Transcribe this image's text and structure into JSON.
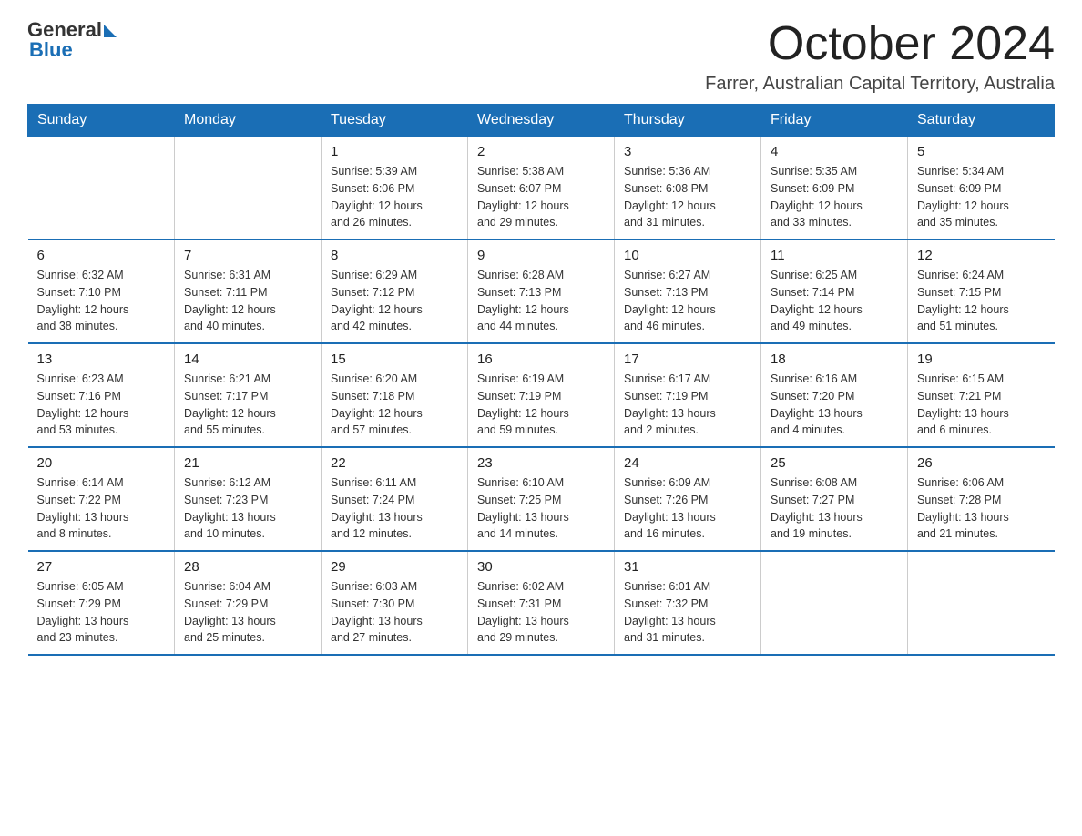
{
  "header": {
    "logo_general": "General",
    "logo_blue": "Blue",
    "title": "October 2024",
    "subtitle": "Farrer, Australian Capital Territory, Australia"
  },
  "calendar": {
    "days_of_week": [
      "Sunday",
      "Monday",
      "Tuesday",
      "Wednesday",
      "Thursday",
      "Friday",
      "Saturday"
    ],
    "weeks": [
      [
        {
          "day": "",
          "info": ""
        },
        {
          "day": "",
          "info": ""
        },
        {
          "day": "1",
          "info": "Sunrise: 5:39 AM\nSunset: 6:06 PM\nDaylight: 12 hours\nand 26 minutes."
        },
        {
          "day": "2",
          "info": "Sunrise: 5:38 AM\nSunset: 6:07 PM\nDaylight: 12 hours\nand 29 minutes."
        },
        {
          "day": "3",
          "info": "Sunrise: 5:36 AM\nSunset: 6:08 PM\nDaylight: 12 hours\nand 31 minutes."
        },
        {
          "day": "4",
          "info": "Sunrise: 5:35 AM\nSunset: 6:09 PM\nDaylight: 12 hours\nand 33 minutes."
        },
        {
          "day": "5",
          "info": "Sunrise: 5:34 AM\nSunset: 6:09 PM\nDaylight: 12 hours\nand 35 minutes."
        }
      ],
      [
        {
          "day": "6",
          "info": "Sunrise: 6:32 AM\nSunset: 7:10 PM\nDaylight: 12 hours\nand 38 minutes."
        },
        {
          "day": "7",
          "info": "Sunrise: 6:31 AM\nSunset: 7:11 PM\nDaylight: 12 hours\nand 40 minutes."
        },
        {
          "day": "8",
          "info": "Sunrise: 6:29 AM\nSunset: 7:12 PM\nDaylight: 12 hours\nand 42 minutes."
        },
        {
          "day": "9",
          "info": "Sunrise: 6:28 AM\nSunset: 7:13 PM\nDaylight: 12 hours\nand 44 minutes."
        },
        {
          "day": "10",
          "info": "Sunrise: 6:27 AM\nSunset: 7:13 PM\nDaylight: 12 hours\nand 46 minutes."
        },
        {
          "day": "11",
          "info": "Sunrise: 6:25 AM\nSunset: 7:14 PM\nDaylight: 12 hours\nand 49 minutes."
        },
        {
          "day": "12",
          "info": "Sunrise: 6:24 AM\nSunset: 7:15 PM\nDaylight: 12 hours\nand 51 minutes."
        }
      ],
      [
        {
          "day": "13",
          "info": "Sunrise: 6:23 AM\nSunset: 7:16 PM\nDaylight: 12 hours\nand 53 minutes."
        },
        {
          "day": "14",
          "info": "Sunrise: 6:21 AM\nSunset: 7:17 PM\nDaylight: 12 hours\nand 55 minutes."
        },
        {
          "day": "15",
          "info": "Sunrise: 6:20 AM\nSunset: 7:18 PM\nDaylight: 12 hours\nand 57 minutes."
        },
        {
          "day": "16",
          "info": "Sunrise: 6:19 AM\nSunset: 7:19 PM\nDaylight: 12 hours\nand 59 minutes."
        },
        {
          "day": "17",
          "info": "Sunrise: 6:17 AM\nSunset: 7:19 PM\nDaylight: 13 hours\nand 2 minutes."
        },
        {
          "day": "18",
          "info": "Sunrise: 6:16 AM\nSunset: 7:20 PM\nDaylight: 13 hours\nand 4 minutes."
        },
        {
          "day": "19",
          "info": "Sunrise: 6:15 AM\nSunset: 7:21 PM\nDaylight: 13 hours\nand 6 minutes."
        }
      ],
      [
        {
          "day": "20",
          "info": "Sunrise: 6:14 AM\nSunset: 7:22 PM\nDaylight: 13 hours\nand 8 minutes."
        },
        {
          "day": "21",
          "info": "Sunrise: 6:12 AM\nSunset: 7:23 PM\nDaylight: 13 hours\nand 10 minutes."
        },
        {
          "day": "22",
          "info": "Sunrise: 6:11 AM\nSunset: 7:24 PM\nDaylight: 13 hours\nand 12 minutes."
        },
        {
          "day": "23",
          "info": "Sunrise: 6:10 AM\nSunset: 7:25 PM\nDaylight: 13 hours\nand 14 minutes."
        },
        {
          "day": "24",
          "info": "Sunrise: 6:09 AM\nSunset: 7:26 PM\nDaylight: 13 hours\nand 16 minutes."
        },
        {
          "day": "25",
          "info": "Sunrise: 6:08 AM\nSunset: 7:27 PM\nDaylight: 13 hours\nand 19 minutes."
        },
        {
          "day": "26",
          "info": "Sunrise: 6:06 AM\nSunset: 7:28 PM\nDaylight: 13 hours\nand 21 minutes."
        }
      ],
      [
        {
          "day": "27",
          "info": "Sunrise: 6:05 AM\nSunset: 7:29 PM\nDaylight: 13 hours\nand 23 minutes."
        },
        {
          "day": "28",
          "info": "Sunrise: 6:04 AM\nSunset: 7:29 PM\nDaylight: 13 hours\nand 25 minutes."
        },
        {
          "day": "29",
          "info": "Sunrise: 6:03 AM\nSunset: 7:30 PM\nDaylight: 13 hours\nand 27 minutes."
        },
        {
          "day": "30",
          "info": "Sunrise: 6:02 AM\nSunset: 7:31 PM\nDaylight: 13 hours\nand 29 minutes."
        },
        {
          "day": "31",
          "info": "Sunrise: 6:01 AM\nSunset: 7:32 PM\nDaylight: 13 hours\nand 31 minutes."
        },
        {
          "day": "",
          "info": ""
        },
        {
          "day": "",
          "info": ""
        }
      ]
    ]
  }
}
